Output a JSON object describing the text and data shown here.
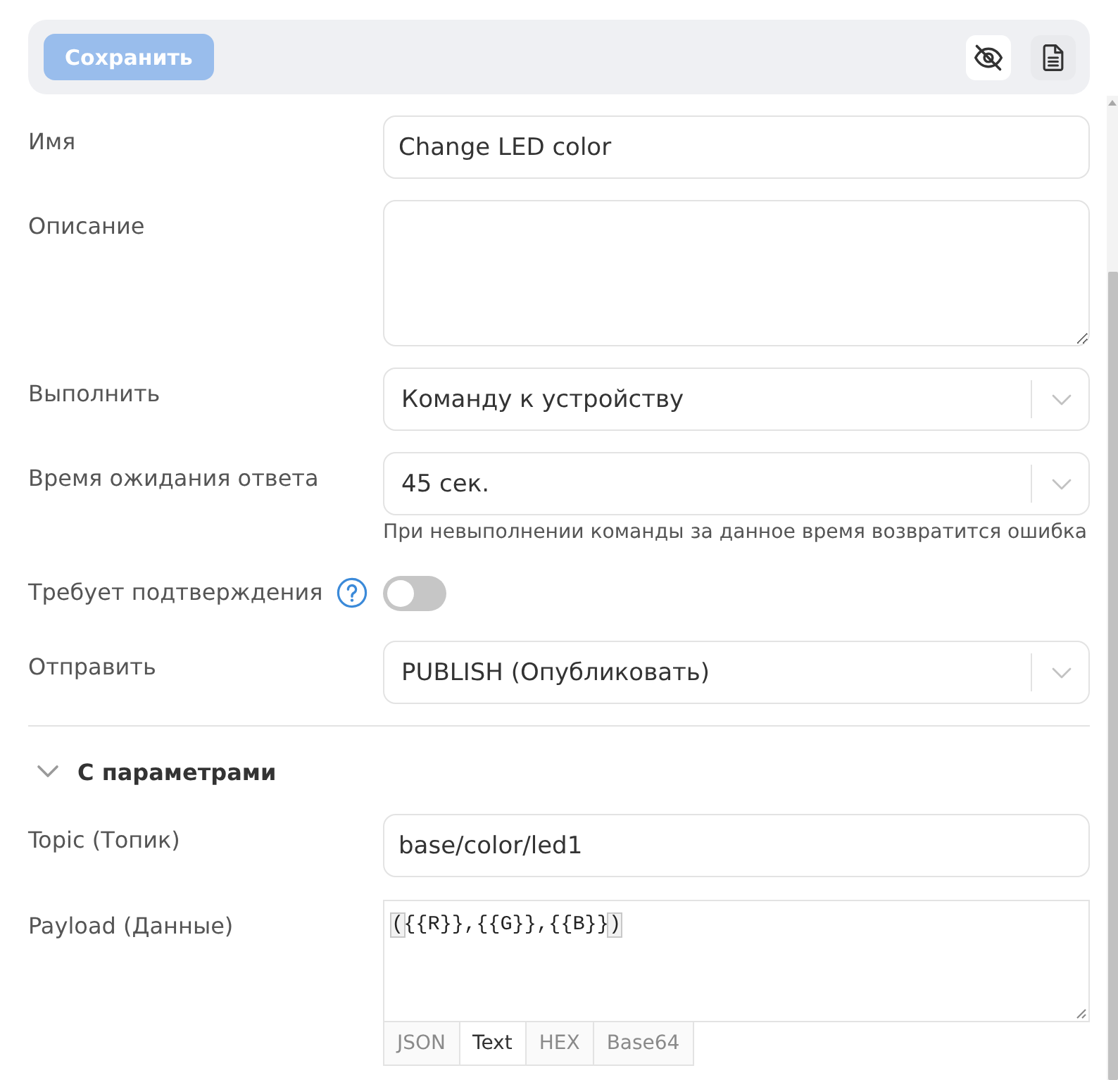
{
  "toolbar": {
    "save_button": {
      "label": "Сохранить",
      "disabled": true
    },
    "tools": [
      {
        "kind": "visibility",
        "on": true
      },
      {
        "kind": "document",
        "on": false
      }
    ]
  },
  "fields": [
    {
      "kind": "text",
      "label": "Имя",
      "value": "Change LED color"
    },
    {
      "kind": "textarea",
      "label": "Описание"
    },
    {
      "kind": "select",
      "label": "Выполнить",
      "value": "Команду к устройству"
    },
    {
      "kind": "select",
      "label": "Время ожидания ответа",
      "value": "45 сек.",
      "hint": "При невыполнении команды за данное время возвратится ошибка"
    },
    {
      "kind": "toggle",
      "label": "Требует подтверждения",
      "help": true,
      "on": false
    },
    {
      "kind": "select",
      "label": "Отправить",
      "value": "PUBLISH (Опубликовать)"
    }
  ],
  "section": {
    "title": "С параметрами",
    "expanded": true,
    "fields": [
      {
        "kind": "text",
        "label": "Topic (Топик)",
        "value": "base/color/led1"
      },
      {
        "kind": "code",
        "label": "Payload (Данные)",
        "value": "({{R}},{{G}},{{B}})",
        "brackets_matched": true,
        "formats": [
          {
            "label": "JSON",
            "selected": false
          },
          {
            "label": "Text",
            "selected": true
          },
          {
            "label": "HEX",
            "selected": false
          },
          {
            "label": "Base64",
            "selected": false
          }
        ]
      }
    ]
  }
}
